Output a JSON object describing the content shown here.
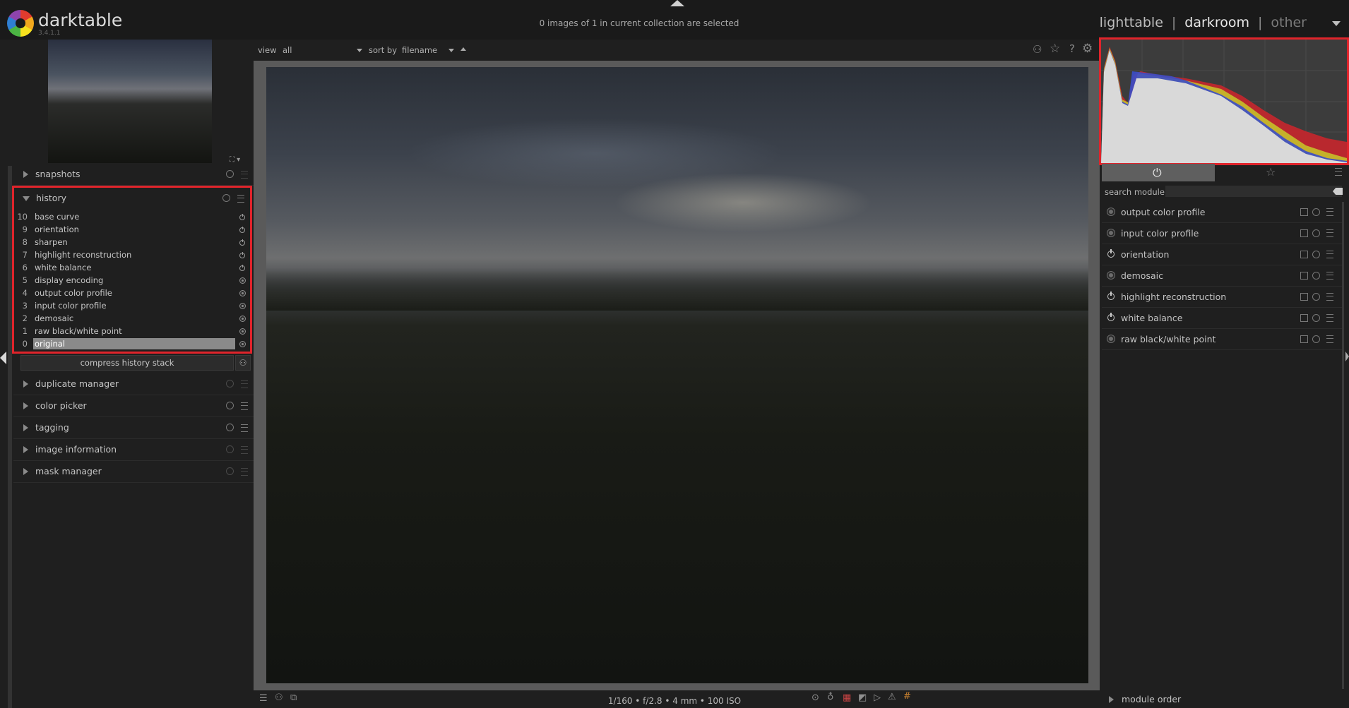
{
  "app": {
    "name": "darktable",
    "version": "3.4.1.1"
  },
  "header": {
    "selection_status": "0 images of 1 in current collection are selected",
    "views": [
      {
        "label": "lighttable",
        "active": false
      },
      {
        "label": "darkroom",
        "active": true
      },
      {
        "label": "other",
        "active": false
      }
    ],
    "separator": "|"
  },
  "filter_bar": {
    "view_label": "view",
    "view_value": "all",
    "sort_label": "sort by",
    "sort_value": "filename"
  },
  "left_panel": {
    "modules_top": [
      {
        "label": "snapshots",
        "expanded": false
      }
    ],
    "history": {
      "label": "history",
      "items": [
        {
          "num": "10",
          "name": "base curve",
          "state": "on"
        },
        {
          "num": "9",
          "name": "orientation",
          "state": "on"
        },
        {
          "num": "8",
          "name": "sharpen",
          "state": "on"
        },
        {
          "num": "7",
          "name": "highlight reconstruction",
          "state": "on"
        },
        {
          "num": "6",
          "name": "white balance",
          "state": "on"
        },
        {
          "num": "5",
          "name": "display encoding",
          "state": "default"
        },
        {
          "num": "4",
          "name": "output color profile",
          "state": "default"
        },
        {
          "num": "3",
          "name": "input color profile",
          "state": "default"
        },
        {
          "num": "2",
          "name": "demosaic",
          "state": "default"
        },
        {
          "num": "1",
          "name": "raw black/white point",
          "state": "default"
        },
        {
          "num": "0",
          "name": "original",
          "state": "default",
          "selected": true
        }
      ],
      "compress_label": "compress history stack"
    },
    "modules_bottom": [
      {
        "label": "duplicate manager"
      },
      {
        "label": "color picker"
      },
      {
        "label": "tagging"
      },
      {
        "label": "image information"
      },
      {
        "label": "mask manager"
      }
    ]
  },
  "footer": {
    "exif": "1/160 • f/2.8 • 4 mm • 100 ISO"
  },
  "right_panel": {
    "search_label": "search module",
    "search_value": "",
    "modules": [
      {
        "label": "output color profile",
        "enabled": false
      },
      {
        "label": "input color profile",
        "enabled": false
      },
      {
        "label": "orientation",
        "enabled": true
      },
      {
        "label": "demosaic",
        "enabled": false
      },
      {
        "label": "highlight reconstruction",
        "enabled": true
      },
      {
        "label": "white balance",
        "enabled": true
      },
      {
        "label": "raw black/white point",
        "enabled": false
      }
    ],
    "module_order_label": "module order"
  },
  "colors": {
    "highlight_box": "#e0242b",
    "background": "#1f1f1f"
  }
}
